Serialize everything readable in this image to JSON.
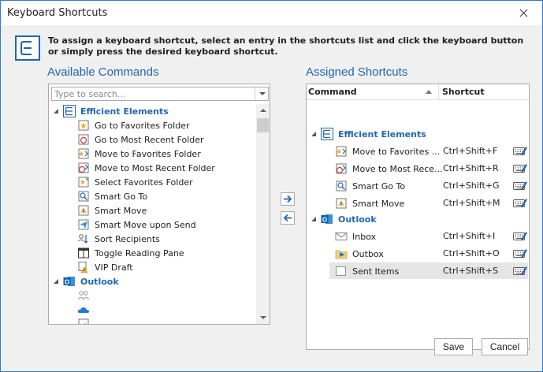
{
  "window": {
    "title": "Keyboard Shortcuts"
  },
  "info": {
    "text": "To assign a keyboard shortcut, select an entry in the shortcuts list and click the keyboard button or simply press the desired keyboard shortcut."
  },
  "available": {
    "title": "Available Commands",
    "search_placeholder": "Type to search...",
    "groups": [
      {
        "name": "Efficient Elements",
        "items": [
          {
            "label": "Go to Favorites Folder",
            "icon": "favorites-folder-icon"
          },
          {
            "label": "Go to Most Recent Folder",
            "icon": "recent-folder-icon"
          },
          {
            "label": "Move to Favorites Folder",
            "icon": "move-favorites-icon"
          },
          {
            "label": "Move to Most Recent Folder",
            "icon": "move-recent-icon"
          },
          {
            "label": "Select Favorites Folder",
            "icon": "select-favorites-icon"
          },
          {
            "label": "Smart Go To",
            "icon": "smart-go-to-icon"
          },
          {
            "label": "Smart Move",
            "icon": "smart-move-icon"
          },
          {
            "label": "Smart Move upon Send",
            "icon": "smart-move-send-icon"
          },
          {
            "label": "Sort Recipients",
            "icon": "sort-recipients-icon"
          },
          {
            "label": "Toggle Reading Pane",
            "icon": "reading-pane-icon"
          },
          {
            "label": "VIP Draft",
            "icon": "vip-draft-icon"
          }
        ]
      },
      {
        "name": "Outlook",
        "items": [
          {
            "label": "",
            "icon": "people-icon"
          },
          {
            "label": "",
            "icon": "onedrive-icon"
          },
          {
            "label": "",
            "icon": "globe-calendar-icon"
          }
        ]
      }
    ]
  },
  "assigned": {
    "title": "Assigned Shortcuts",
    "columns": {
      "command": "Command",
      "shortcut": "Shortcut"
    },
    "groups": [
      {
        "name": "Efficient Elements",
        "items": [
          {
            "label": "Move to Favorites ...",
            "shortcut": "Ctrl+Shift+F",
            "icon": "move-favorites-icon"
          },
          {
            "label": "Move to Most Rece...",
            "shortcut": "Ctrl+Shift+R",
            "icon": "move-recent-icon"
          },
          {
            "label": "Smart Go To",
            "shortcut": "Ctrl+Shift+G",
            "icon": "smart-go-to-icon"
          },
          {
            "label": "Smart Move",
            "shortcut": "Ctrl+Shift+M",
            "icon": "smart-move-icon"
          }
        ]
      },
      {
        "name": "Outlook",
        "items": [
          {
            "label": "Inbox",
            "shortcut": "Ctrl+Shift+I",
            "icon": "inbox-icon"
          },
          {
            "label": "Outbox",
            "shortcut": "Ctrl+Shift+O",
            "icon": "outbox-icon"
          },
          {
            "label": "Sent Items",
            "shortcut": "Ctrl+Shift+S",
            "icon": "sent-items-icon"
          }
        ]
      }
    ]
  },
  "buttons": {
    "save": "Save",
    "cancel": "Cancel"
  },
  "colors": {
    "accent": "#1f66b5",
    "outlook": "#0a64ad",
    "selection": "#e5e5e5"
  }
}
